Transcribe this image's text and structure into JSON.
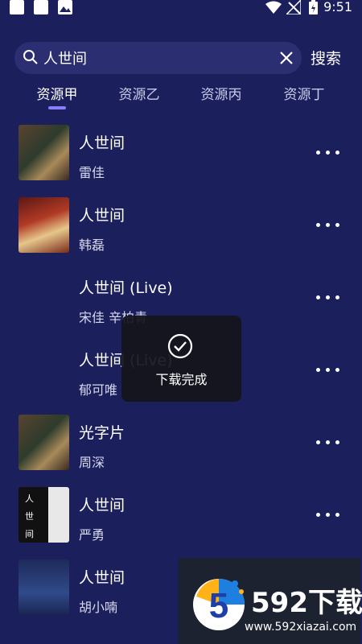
{
  "status_bar": {
    "time": "9:51"
  },
  "search": {
    "value": "人世间",
    "button_label": "搜索"
  },
  "tabs": [
    {
      "label": "资源甲",
      "active": true
    },
    {
      "label": "资源乙",
      "active": false
    },
    {
      "label": "资源丙",
      "active": false
    },
    {
      "label": "资源丁",
      "active": false
    }
  ],
  "songs": [
    {
      "title": "人世间",
      "artist": "雷佳"
    },
    {
      "title": "人世间",
      "artist": "韩磊"
    },
    {
      "title": "人世间 (Live)",
      "artist": "宋佳  辛柏青"
    },
    {
      "title": "人世间 (Live)",
      "artist": "郁可唯"
    },
    {
      "title": "光字片",
      "artist": "周深"
    },
    {
      "title": "人世间",
      "artist": "严勇"
    },
    {
      "title": "人世间",
      "artist": "胡小喃"
    }
  ],
  "cover_3": {
    "chars": [
      "人",
      "世",
      "间"
    ]
  },
  "toast": {
    "text": "下载完成"
  },
  "watermark": {
    "logo_digit": "5",
    "title": "592下载",
    "url": "www.592xiazai.com"
  },
  "colors": {
    "background": "#1b1f5c",
    "search_box": "#2b2f72",
    "accent": "#8a7dff"
  }
}
